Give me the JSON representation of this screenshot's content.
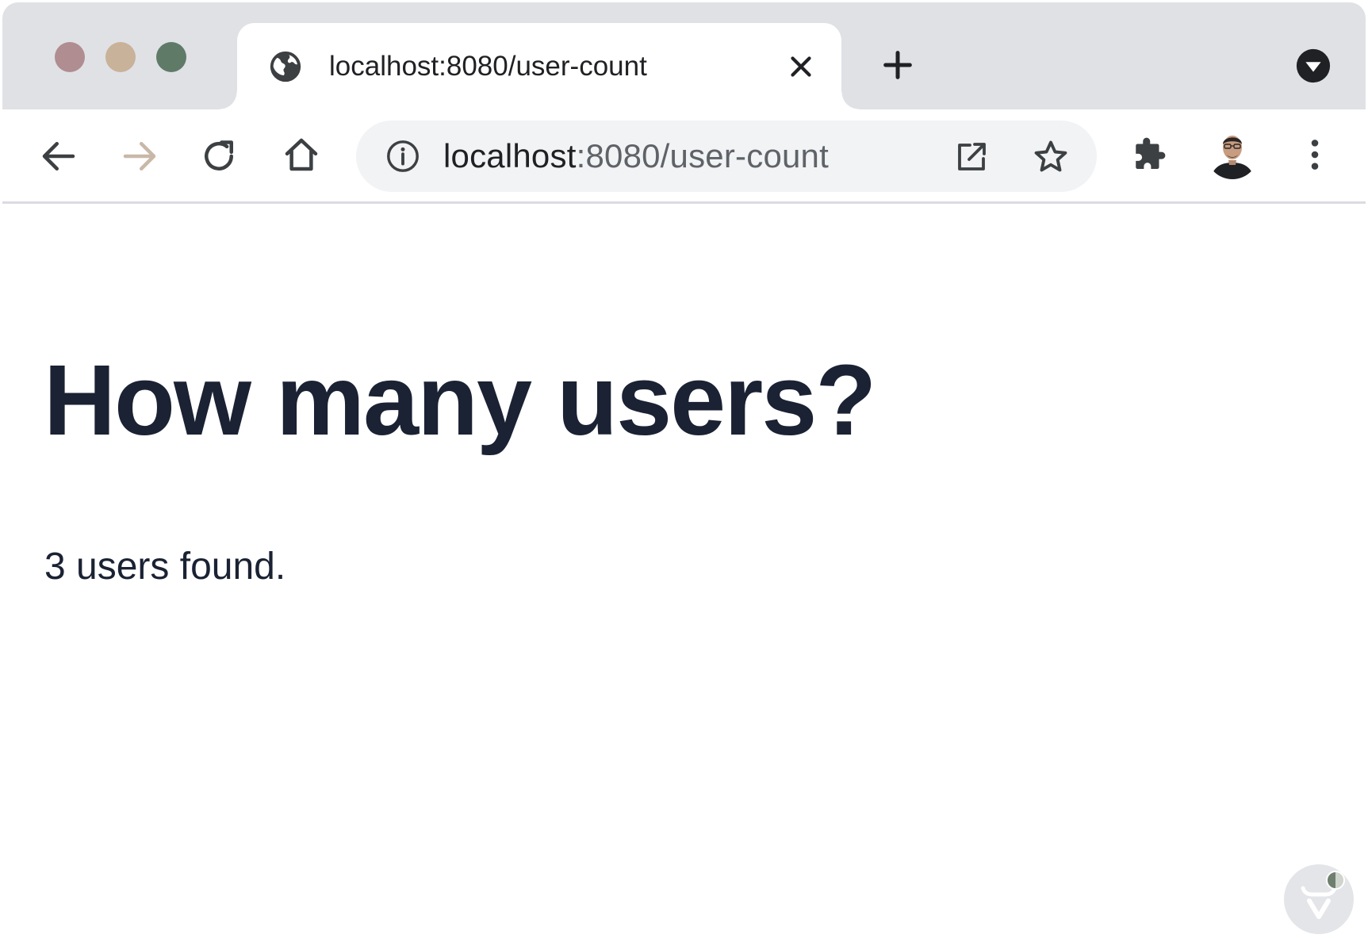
{
  "window": {
    "traffic_colors": {
      "close": "#b08d90",
      "minimize": "#c8b299",
      "maximize": "#5f7b68"
    }
  },
  "tab": {
    "title": "localhost:8080/user-count",
    "favicon": "globe-icon",
    "close_icon": "close-icon"
  },
  "toolbar": {
    "back_icon": "arrow-left-icon",
    "forward_icon": "arrow-right-icon",
    "reload_icon": "reload-icon",
    "home_icon": "home-icon",
    "extensions_icon": "puzzle-icon",
    "menu_icon": "kebab-menu-icon"
  },
  "omnibox": {
    "host": "localhost",
    "rest": ":8080/user-count",
    "info_icon": "info-icon",
    "open_icon": "open-in-new-icon",
    "bookmark_icon": "star-icon"
  },
  "page": {
    "heading": "How many users?",
    "count_text": "3 users found."
  },
  "colors": {
    "heading": "#1a2233",
    "titlebar": "#dfe1e5",
    "omnibox": "#f1f3f4"
  }
}
